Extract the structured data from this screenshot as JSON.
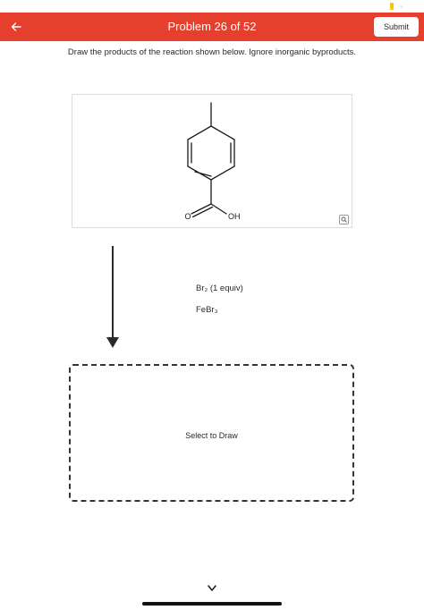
{
  "header": {
    "title": "Problem 26 of 52",
    "submit_label": "Submit",
    "background_color": "#e5402d"
  },
  "icons": {
    "back": "arrow-left-icon",
    "zoom": "magnifier-icon",
    "bottom": "chevron-down-icon"
  },
  "instruction": "Draw the products of the reaction shown below. Ignore inorganic byproducts.",
  "reactant": {
    "atom_labels": [
      "O",
      "OH"
    ]
  },
  "reagents": [
    "Br₂ (1 equiv)",
    "FeBr₃"
  ],
  "draw_area": {
    "label": "Select to Draw"
  }
}
